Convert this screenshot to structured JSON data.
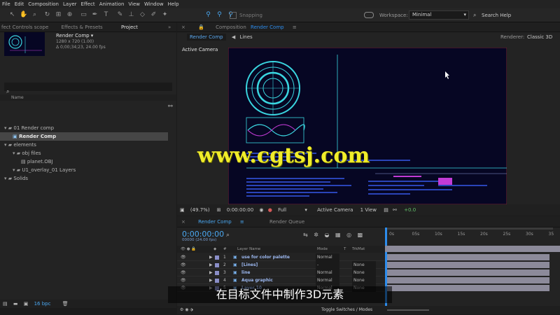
{
  "menu": [
    "File",
    "Edit",
    "Composition",
    "Layer",
    "Effect",
    "Animation",
    "View",
    "Window",
    "Help"
  ],
  "toolbar": {
    "snapping": "Snapping",
    "workspace_label": "Workspace:",
    "workspace_value": "Minimal",
    "search_help": "Search Help"
  },
  "left_tabs": [
    "fect Controls scope",
    "Effects & Presets",
    "Project"
  ],
  "project": {
    "comp_name": "Render Comp ▾",
    "comp_size": "1280 x 720 (1.00)",
    "comp_duration": "Δ 0;00;34;23, 24.00 fps",
    "search_placeholder": "",
    "name_header": "Name",
    "bpc": "16 bpc"
  },
  "tree": [
    {
      "label": "01 Render comp",
      "level": 0,
      "type": "folder"
    },
    {
      "label": "Render Comp",
      "level": 1,
      "type": "comp",
      "selected": true
    },
    {
      "label": "elements",
      "level": 0,
      "type": "folder"
    },
    {
      "label": "obj files",
      "level": 1,
      "type": "folder"
    },
    {
      "label": "planet.OBJ",
      "level": 2,
      "type": "file"
    },
    {
      "label": "U1_overlay_01 Layers",
      "level": 1,
      "type": "folder"
    },
    {
      "label": "Solids",
      "level": 0,
      "type": "folder"
    }
  ],
  "viewer": {
    "tab_prefix": "Composition",
    "tab_name": "Render Comp",
    "subtab_render": "Render Comp",
    "subtab_lines": "Lines",
    "renderer_label": "Renderer:",
    "renderer_value": "Classic 3D",
    "camera_label": "Active Camera"
  },
  "viewer_controls": {
    "zoom": "(49.7%)",
    "time": "0:00:00:00",
    "resolution": "Full",
    "camera": "Active Camera",
    "views": "1 View",
    "exposure": "+0.0"
  },
  "timeline": {
    "tab_label": "Render Comp",
    "render_queue": "Render Queue",
    "timecode": "0:00:00:00",
    "fps_label": "00000 (24.00 fps)",
    "col_layer_name": "Layer Name",
    "col_mode": "Mode",
    "col_t": "T",
    "col_trkmat": "TrkMat",
    "ruler": [
      "0s",
      "05s",
      "10s",
      "15s",
      "20s",
      "25s",
      "30s",
      "35"
    ],
    "toggle_switches": "Toggle Switches / Modes"
  },
  "layers": [
    {
      "num": "1",
      "name": "use for color palette",
      "mode": "Normal",
      "trkmat": ""
    },
    {
      "num": "2",
      "name": "[Lines]",
      "mode": "-",
      "trkmat": "None"
    },
    {
      "num": "3",
      "name": "line",
      "mode": "Normal",
      "trkmat": "None"
    },
    {
      "num": "4",
      "name": "Aqua graphic",
      "mode": "Normal",
      "trkmat": "None"
    },
    {
      "num": "5",
      "name": "Layer 10",
      "mode": "Normal",
      "trkmat": "None"
    }
  ],
  "subtitle": "在目标文件中制作3D元素",
  "watermark": "www.cgtsj.com",
  "colors": {
    "accent": "#2d8ceb",
    "comp_bg": "#060623",
    "cyan": "#3ad6e0",
    "magenta": "#c23bd6",
    "bar": "#8c8a9a"
  }
}
